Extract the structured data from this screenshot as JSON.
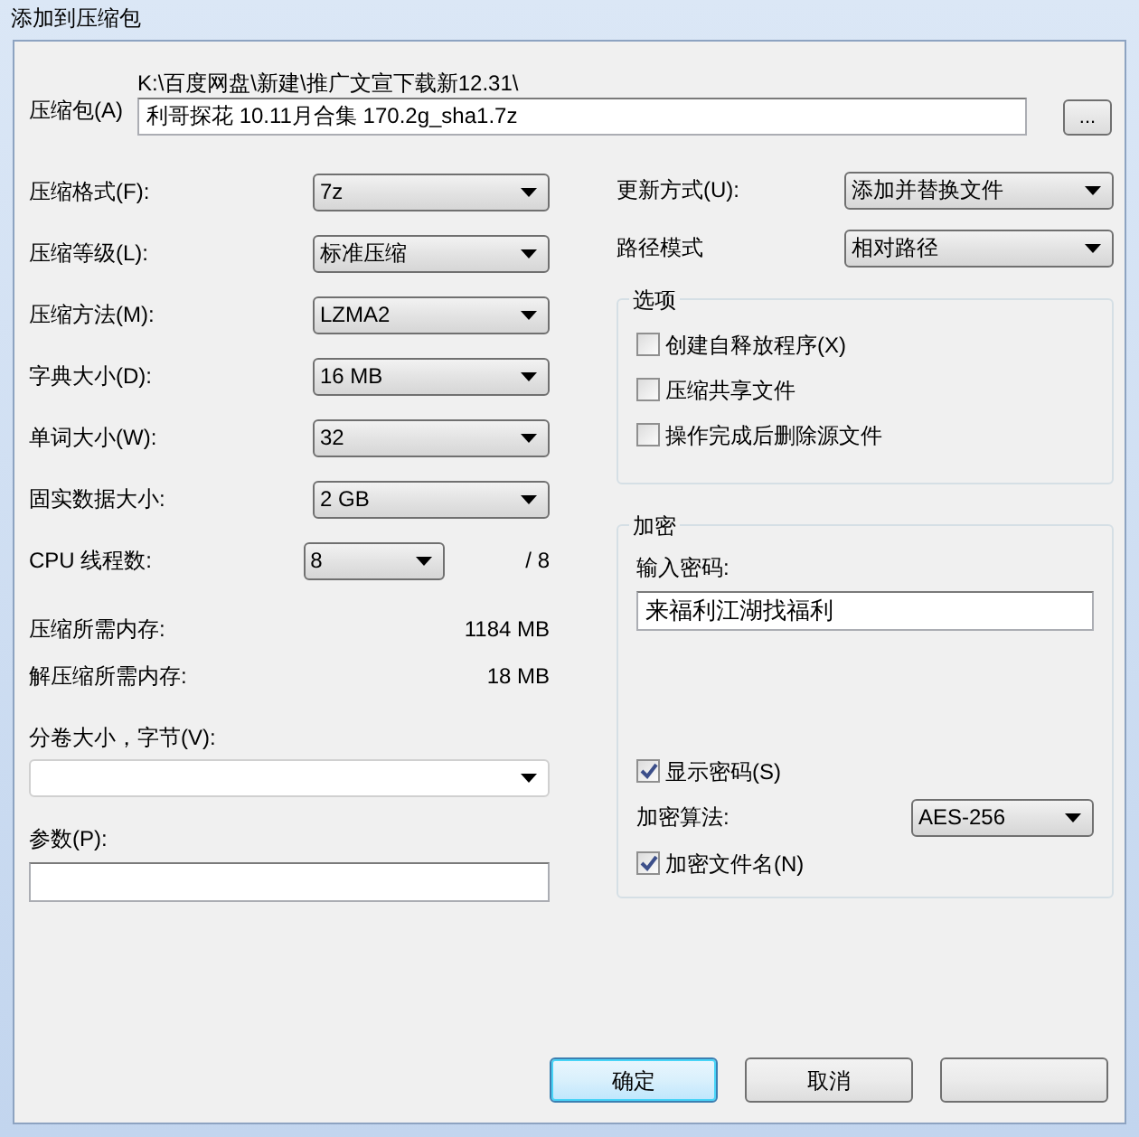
{
  "window": {
    "title": "添加到压缩包"
  },
  "archive": {
    "label": "压缩包(A)",
    "path": "K:\\百度网盘\\新建\\推广文宣下载新12.31\\",
    "filename": "利哥探花 10.11月合集 170.2g_sha1.7z",
    "browse_label": "..."
  },
  "left_fields": [
    {
      "kind": "select",
      "label": "压缩格式(F):",
      "value": "7z"
    },
    {
      "kind": "select",
      "label": "压缩等级(L):",
      "value": "标准压缩"
    },
    {
      "kind": "select",
      "label": "压缩方法(M):",
      "value": "LZMA2"
    },
    {
      "kind": "select",
      "label": "字典大小(D):",
      "value": "16 MB"
    },
    {
      "kind": "select",
      "label": "单词大小(W):",
      "value": "32"
    },
    {
      "kind": "select",
      "label": "固实数据大小:",
      "value": "2 GB"
    },
    {
      "kind": "short_select",
      "label": "CPU 线程数:",
      "value": "8",
      "suffix": "/ 8"
    },
    {
      "kind": "info",
      "label": "压缩所需内存:",
      "value": "1184 MB"
    },
    {
      "kind": "info",
      "label": "解压缩所需内存:",
      "value": "18 MB"
    }
  ],
  "volume": {
    "label": "分卷大小，字节(V):"
  },
  "parameters": {
    "label": "参数(P):"
  },
  "right_fields": [
    {
      "label": "更新方式(U):",
      "value": "添加并替换文件"
    },
    {
      "label": "路径模式",
      "value": "相对路径"
    }
  ],
  "options": {
    "title": "选项",
    "items": [
      {
        "label": "创建自释放程序(X)",
        "checked": false
      },
      {
        "label": "压缩共享文件",
        "checked": false
      },
      {
        "label": "操作完成后删除源文件",
        "checked": false
      }
    ]
  },
  "encryption": {
    "title": "加密",
    "password_label": "输入密码:",
    "password": "来福利江湖找福利",
    "show_password": {
      "label": "显示密码(S)",
      "checked": true
    },
    "method_label": "加密算法:",
    "method": "AES-256",
    "encrypt_names": {
      "label": "加密文件名(N)",
      "checked": true
    }
  },
  "buttons": [
    {
      "label": "确定",
      "default": true
    },
    {
      "label": "取消",
      "default": false
    },
    {
      "default": false
    }
  ]
}
